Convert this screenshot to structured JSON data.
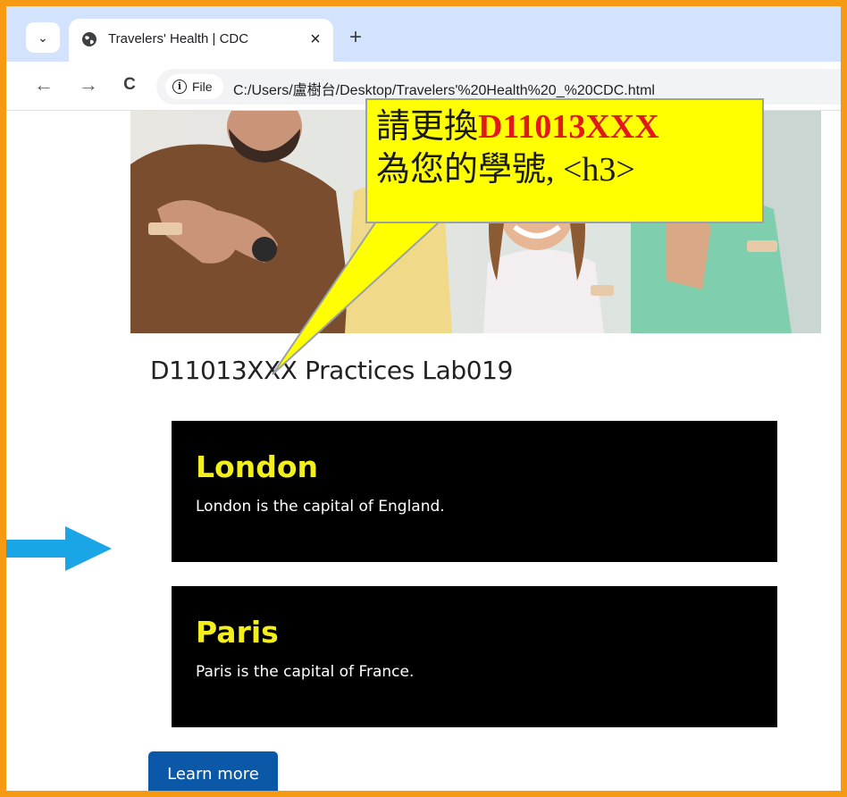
{
  "browser": {
    "tab_title": "Travelers' Health | CDC",
    "tab_close": "×",
    "new_tab": "+",
    "tab_menu": "⌄",
    "nav_back": "←",
    "nav_forward": "→",
    "nav_reload": "C",
    "chip_label": "File",
    "url": "C:/Users/盧樹台/Desktop/Travelers'%20Health%20_%20CDC.html"
  },
  "page": {
    "heading": "D11013XXX Practices Lab019",
    "cards": [
      {
        "title": "London",
        "text": "London is the capital of England."
      },
      {
        "title": "Paris",
        "text": "Paris is the capital of France."
      }
    ],
    "button_label": "Learn more"
  },
  "callout": {
    "line1_prefix": "請更換",
    "line1_id": "D11013XXX",
    "line2": "為您的學號, <h3>"
  },
  "colors": {
    "frame": "#f59a12",
    "card_bg": "#000000",
    "card_title": "#f2ef1c",
    "button": "#0b57a8",
    "callout_bg": "#ffff00",
    "callout_id": "#e0191b",
    "arrow": "#1aa6e6"
  }
}
